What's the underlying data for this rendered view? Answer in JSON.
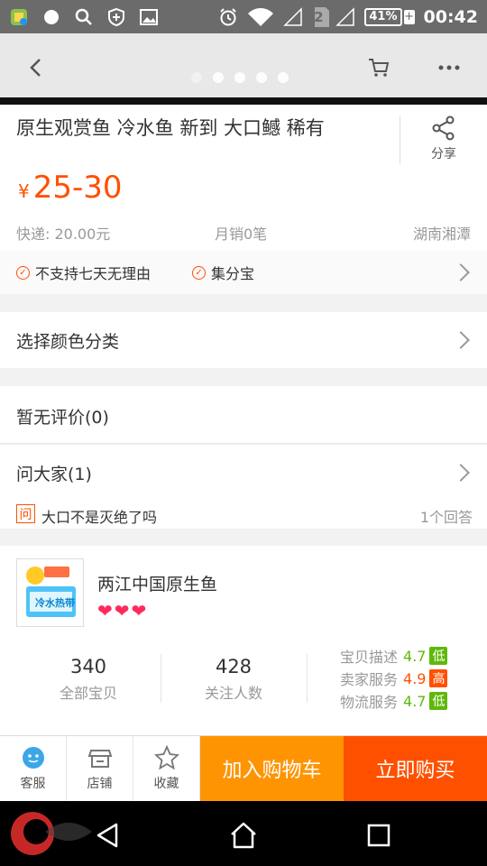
{
  "status_bar": {
    "battery": "41%",
    "sim": "2",
    "time": "00:42"
  },
  "product": {
    "title": "原生观赏鱼 冷水鱼 新到 大口鳡 稀有",
    "share_label": "分享",
    "price_symbol": "¥",
    "price": "25-30",
    "shipping": "快递: 20.00元",
    "monthly_sales": "月销0笔",
    "location": "湖南湘潭",
    "services": [
      "不支持七天无理由",
      "集分宝"
    ]
  },
  "options": {
    "select_color": "选择颜色分类"
  },
  "reviews": {
    "label": "暂无评价(0)"
  },
  "qa": {
    "label": "问大家(1)",
    "badge": "问",
    "question": "大口不是灭绝了吗",
    "answers": "1个回答"
  },
  "shop": {
    "name": "两江中国原生鱼",
    "logo_text": "冷水热带",
    "hearts": 3,
    "total_items": "340",
    "total_items_label": "全部宝贝",
    "followers": "428",
    "followers_label": "关注人数",
    "scores": [
      {
        "label": "宝贝描述",
        "value": "4.7",
        "level": "低",
        "color": "#5fb80a"
      },
      {
        "label": "卖家服务",
        "value": "4.9",
        "level": "高",
        "color": "#ff5000"
      },
      {
        "label": "物流服务",
        "value": "4.7",
        "level": "低",
        "color": "#5fb80a"
      }
    ]
  },
  "action_bar": {
    "service_label": "客服",
    "shop_label": "店铺",
    "favorite_label": "收藏",
    "add_to_cart": "加入购物车",
    "buy_now": "立即购买"
  },
  "colors": {
    "accent": "#ff5000",
    "cart_button": "#ff9402",
    "heart": "#ff2a5b"
  }
}
